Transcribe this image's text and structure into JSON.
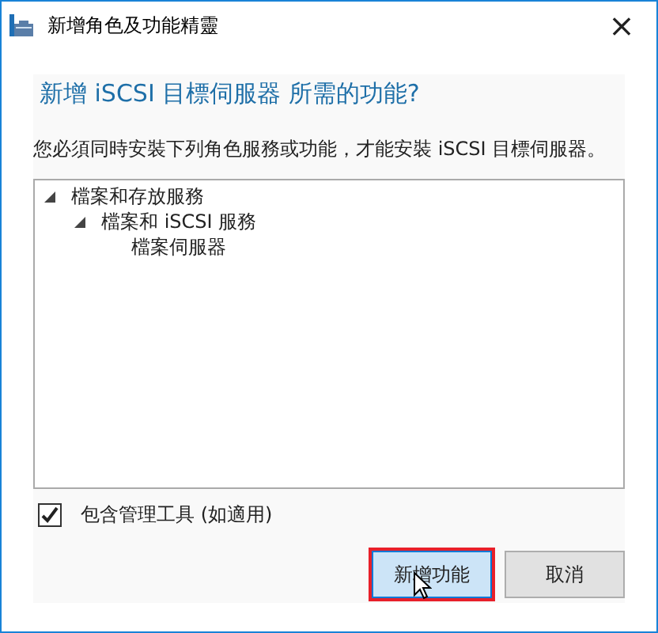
{
  "window": {
    "title": "新增角色及功能精靈",
    "close": "×"
  },
  "heading": "新增 iSCSI 目標伺服器 所需的功能?",
  "description": "您必須同時安裝下列角色服務或功能，才能安裝 iSCSI 目標伺服器。",
  "tree": [
    {
      "label": "檔案和存放服務",
      "expanded": true,
      "children": [
        {
          "label": "檔案和 iSCSI 服務",
          "expanded": true,
          "children": [
            {
              "label": "檔案伺服器"
            }
          ]
        }
      ]
    }
  ],
  "include_tools": {
    "label": "包含管理工具 (如適用)",
    "checked": true
  },
  "buttons": [
    {
      "label": "新增功能",
      "highlighted": true
    },
    {
      "label": "取消",
      "highlighted": false
    }
  ]
}
